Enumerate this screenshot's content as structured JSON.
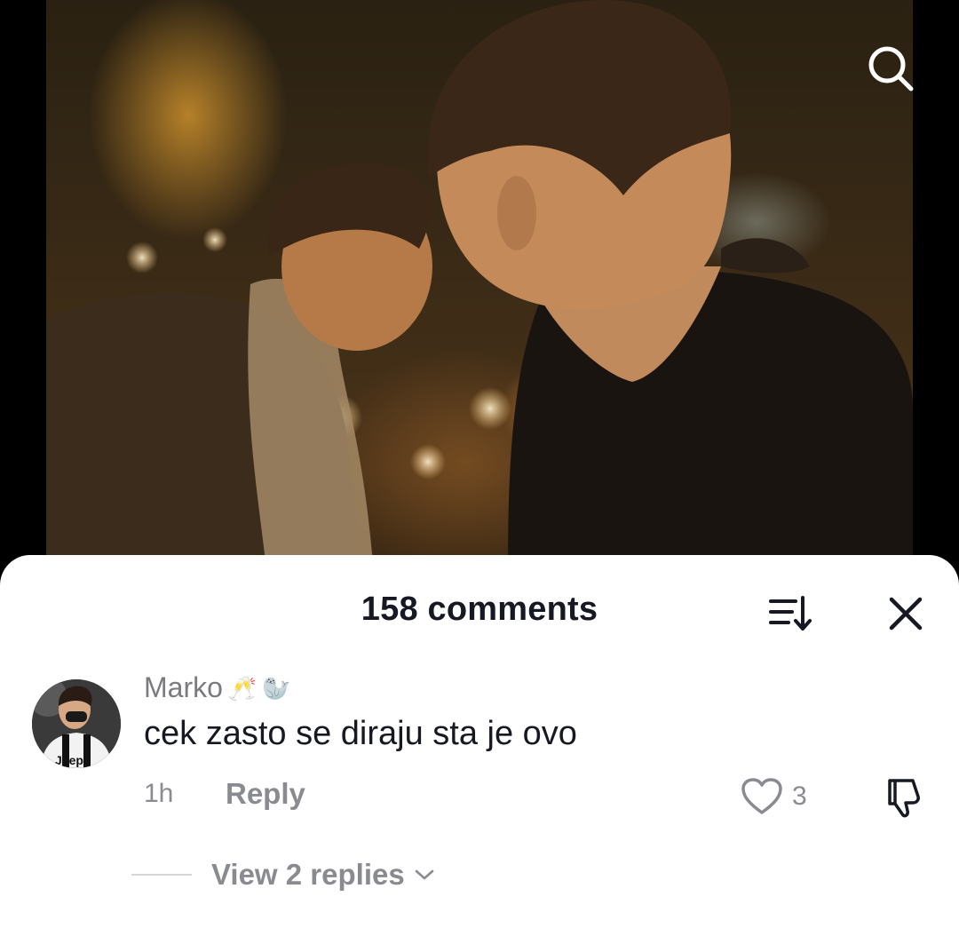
{
  "video": {
    "search_icon": "search-icon"
  },
  "comments_sheet": {
    "title": "158 comments",
    "sort_icon": "sort-icon",
    "close_icon": "close-icon"
  },
  "comment": {
    "username": "Marko",
    "username_emojis": [
      "🥂",
      "🦭"
    ],
    "text": "cek zasto se diraju sta je ovo",
    "time": "1h",
    "reply_label": "Reply",
    "like_count": "3",
    "avatar_jersey_text": "Jeep",
    "view_replies_label": "View 2 replies"
  },
  "colors": {
    "title": "#161823",
    "secondary_text": "#8a8b91",
    "sheet_background": "#ffffff"
  }
}
